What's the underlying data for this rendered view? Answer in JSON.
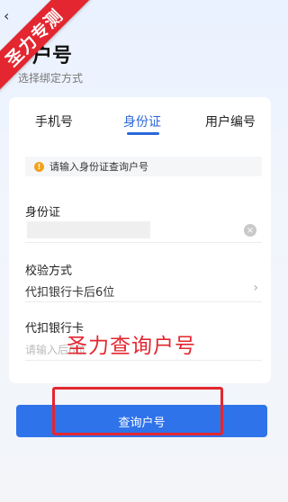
{
  "nav": {
    "back_icon": "chevron-left-icon",
    "back_glyph": "‹"
  },
  "corner_badge": "圣力专测",
  "header": {
    "title": "户号",
    "subtitle": "选择绑定方式"
  },
  "tabs": [
    {
      "label": "手机号",
      "active": false
    },
    {
      "label": "身份证",
      "active": true
    },
    {
      "label": "用户编号",
      "active": false
    }
  ],
  "notice": {
    "icon": "warning-icon",
    "icon_glyph": "!",
    "text": "请输入身份证查询户号"
  },
  "form": {
    "id_card": {
      "label": "身份证",
      "value": "",
      "clear_glyph": "×"
    },
    "verify_method": {
      "label": "校验方式",
      "value": "代扣银行卡后6位",
      "chevron_glyph": "›"
    },
    "bank_card": {
      "label": "代扣银行卡",
      "placeholder": "请输入后6位"
    }
  },
  "overlay_text": "圣力查询户号",
  "submit_button": {
    "label": "查询户号"
  },
  "colors": {
    "accent": "#2f73ea",
    "tab_active": "#2b67d8",
    "marker": "#e3262f",
    "warning": "#f3a21b"
  }
}
